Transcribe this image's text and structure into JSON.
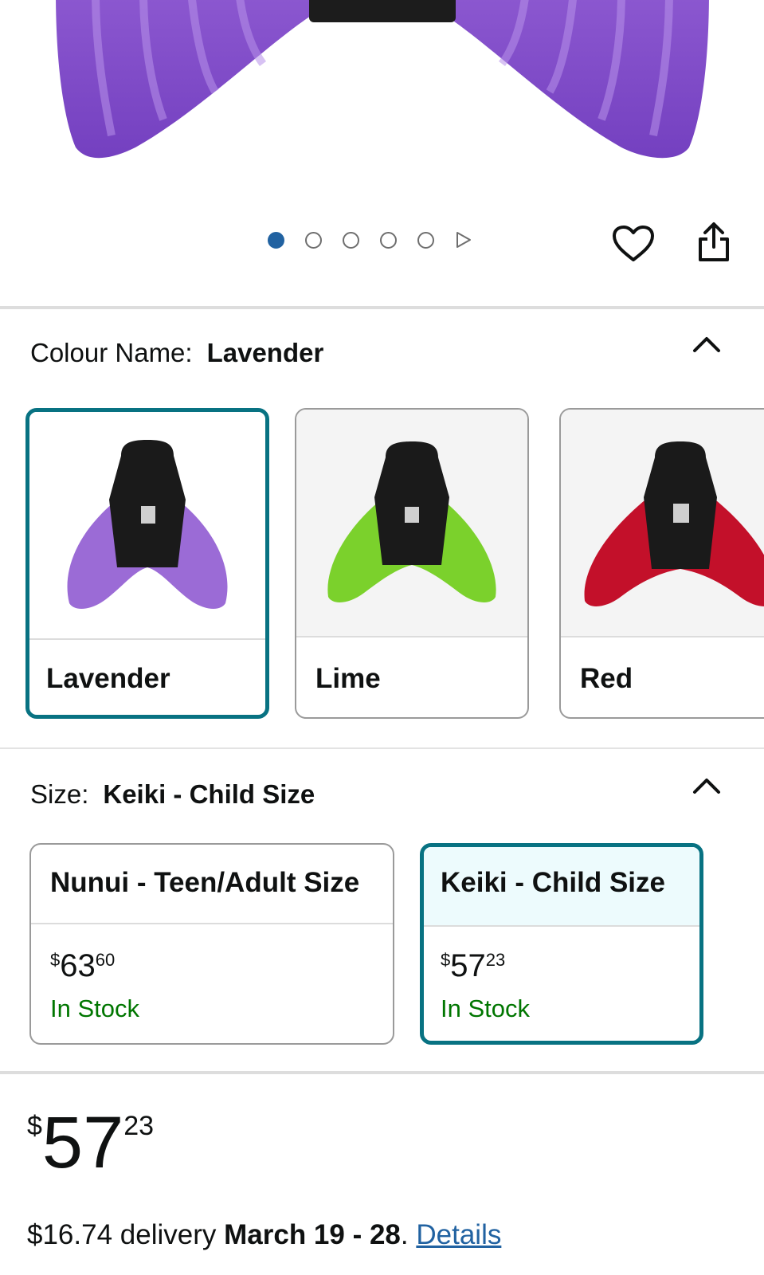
{
  "hero": {
    "image_alt": "Lavender mermaid fin",
    "accent": "#9b6bd6"
  },
  "carousel": {
    "total_dots": 5,
    "active_index": 0,
    "play_icon": "play-icon"
  },
  "actions": {
    "favorite_icon": "heart-icon",
    "share_icon": "share-icon"
  },
  "colour": {
    "label": "Colour Name:",
    "selected": "Lavender",
    "options": [
      {
        "label": "Lavender",
        "fin_color": "#9b6bd6",
        "selected": true
      },
      {
        "label": "Lime",
        "fin_color": "#7bd12c",
        "selected": false
      },
      {
        "label": "Red",
        "fin_color": "#c3102a",
        "selected": false
      }
    ]
  },
  "size": {
    "label": "Size:",
    "selected": "Keiki - Child Size",
    "options": [
      {
        "name": "Nunui - Teen/Adult Size",
        "price_symbol": "$",
        "price_whole": "63",
        "price_fraction": "60",
        "stock": "In Stock",
        "selected": false
      },
      {
        "name": "Keiki - Child Size",
        "price_symbol": "$",
        "price_whole": "57",
        "price_fraction": "23",
        "stock": "In Stock",
        "selected": true
      }
    ]
  },
  "price": {
    "symbol": "$",
    "whole": "57",
    "fraction": "23"
  },
  "delivery": {
    "cost_text": "$16.74 delivery",
    "date_range": "March 19 - 28",
    "period": ".",
    "details_link": "Details"
  },
  "colors": {
    "selected_border": "#087282",
    "in_stock": "#007600",
    "link": "#2162a1",
    "dot_active": "#2162a1"
  }
}
